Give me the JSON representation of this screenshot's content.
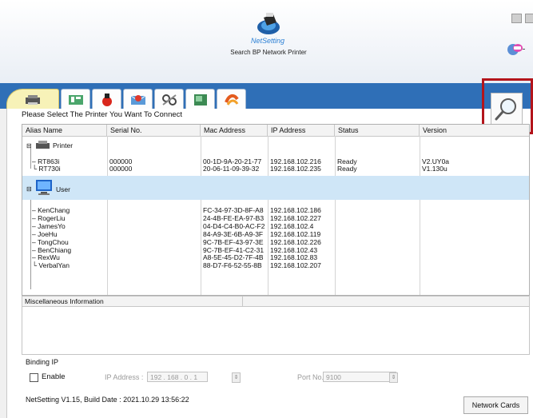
{
  "header": {
    "logo_word": "NetSetting",
    "subtitle": "Search BP Network Printer"
  },
  "tabs": [
    {
      "name": "printer"
    },
    {
      "name": "network"
    },
    {
      "name": "usb"
    },
    {
      "name": "mail"
    },
    {
      "name": "tools"
    },
    {
      "name": "sky"
    },
    {
      "name": "links"
    }
  ],
  "select_label": "Please Select The Printer You Want To Connect",
  "grid": {
    "columns": [
      "Alias Name",
      "Serial No.",
      "Mac Address",
      "IP Address",
      "Status",
      "Version"
    ],
    "printer_group": "Printer",
    "printers": [
      {
        "alias": "RT863i",
        "serial": "000000",
        "mac": "00-1D-9A-20-21-77",
        "ip": "192.168.102.216",
        "status": "Ready",
        "version": "V2.UY0a"
      },
      {
        "alias": "RT730i",
        "serial": "000000",
        "mac": "20-06-11-09-39-32",
        "ip": "192.168.102.235",
        "status": "Ready",
        "version": "V1.130u"
      }
    ],
    "user_group": "User",
    "users": [
      {
        "alias": "KenChang",
        "mac": "FC-34-97-3D-8F-A8",
        "ip": "192.168.102.186"
      },
      {
        "alias": "RogerLiu",
        "mac": "24-4B-FE-EA-97-B3",
        "ip": "192.168.102.227"
      },
      {
        "alias": "JamesYo",
        "mac": "04-D4-C4-B0-AC-F2",
        "ip": "192.168.102.4"
      },
      {
        "alias": "JoeHu",
        "mac": "84-A9-3E-6B-A9-3F",
        "ip": "192.168.102.119"
      },
      {
        "alias": "TongChou",
        "mac": "9C-7B-EF-43-97-3E",
        "ip": "192.168.102.226"
      },
      {
        "alias": "BenChiang",
        "mac": "9C-7B-EF-41-C2-31",
        "ip": "192.168.102.43"
      },
      {
        "alias": "RexWu",
        "mac": "A8-5E-45-D2-7F-4B",
        "ip": "192.168.102.83"
      },
      {
        "alias": "VerbalYan",
        "mac": "88-D7-F6-52-55-8B",
        "ip": "192.168.102.207"
      }
    ]
  },
  "misc": {
    "title": "Miscellaneous Information"
  },
  "binding": {
    "title": "Binding IP",
    "enable_label": "Enable",
    "ip_label": "IP Address :",
    "ip_value": "192 . 168 . 0 . 1",
    "port_label": "Port No.",
    "port_value": "9100"
  },
  "footer": {
    "build": "NetSetting V1.15, Build Date : 2021.10.29 13:56:22",
    "network_cards_label": "Network Cards"
  },
  "colors": {
    "tab_bar": "#2f6fb7",
    "user_row_bg": "#cfe6f7",
    "highlight": "#b3141b"
  }
}
